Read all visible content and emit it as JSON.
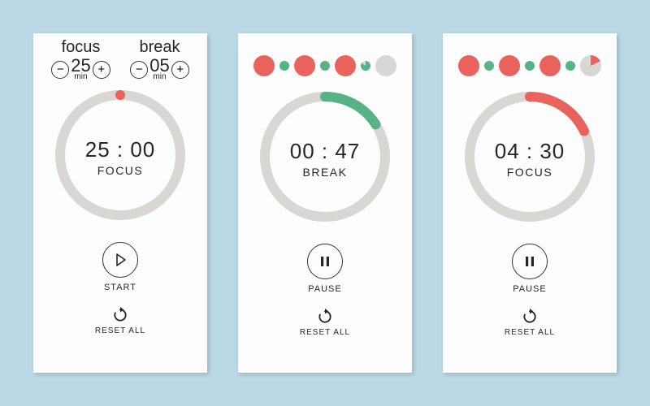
{
  "colors": {
    "red": "#e9635c",
    "green": "#57b386",
    "track": "#d9d7d3",
    "ink": "#262626"
  },
  "card1": {
    "focus_label": "focus",
    "break_label": "break",
    "focus_value": "25",
    "break_value": "05",
    "unit": "min",
    "minus": "−",
    "plus": "+",
    "time": "25 : 00",
    "mode": "FOCUS",
    "control_label": "START",
    "reset_label": "RESET ALL",
    "progress_fraction": 0.0,
    "progress_color": "#e9635c"
  },
  "card2": {
    "dots": [
      {
        "type": "focus-done"
      },
      {
        "type": "break-done"
      },
      {
        "type": "focus-done"
      },
      {
        "type": "break-done"
      },
      {
        "type": "focus-done"
      },
      {
        "type": "break-progress",
        "fraction": 0.84
      },
      {
        "type": "focus-empty"
      }
    ],
    "time": "00 : 47",
    "mode": "BREAK",
    "control_label": "PAUSE",
    "reset_label": "RESET ALL",
    "progress_fraction": 0.16,
    "progress_color": "#57b386"
  },
  "card3": {
    "dots": [
      {
        "type": "focus-done"
      },
      {
        "type": "break-done"
      },
      {
        "type": "focus-done"
      },
      {
        "type": "break-done"
      },
      {
        "type": "focus-done"
      },
      {
        "type": "break-done"
      },
      {
        "type": "focus-progress",
        "fraction": 0.18
      }
    ],
    "time": "04 : 30",
    "mode": "FOCUS",
    "control_label": "PAUSE",
    "reset_label": "RESET ALL",
    "progress_fraction": 0.18,
    "progress_color": "#e9635c"
  }
}
